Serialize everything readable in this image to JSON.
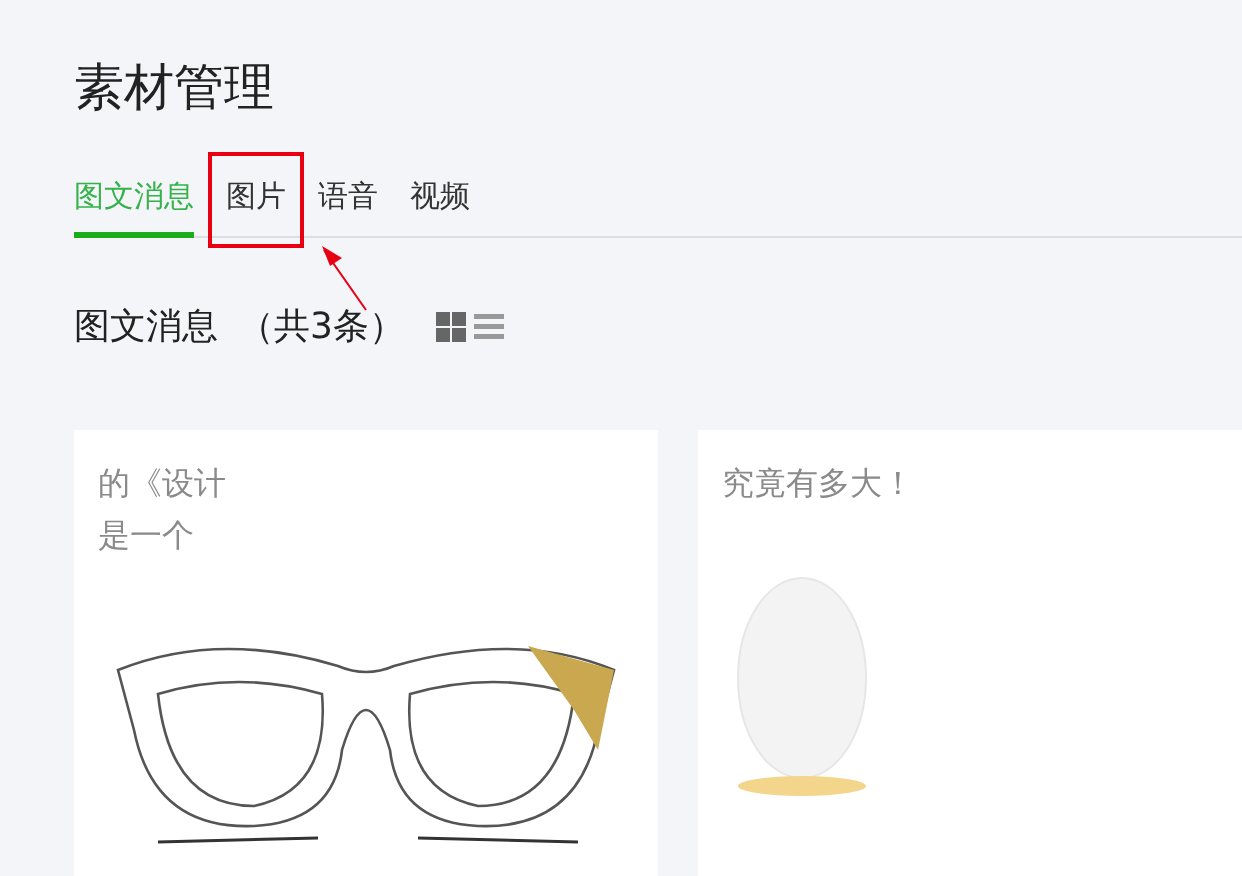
{
  "page_title": "素材管理",
  "tabs": [
    {
      "label": "图文消息",
      "selected": true,
      "highlighted": false
    },
    {
      "label": "图片",
      "selected": false,
      "highlighted": true
    },
    {
      "label": "语音",
      "selected": false,
      "highlighted": false
    },
    {
      "label": "视频",
      "selected": false,
      "highlighted": false
    }
  ],
  "section": {
    "title": "图文消息",
    "count": "（共3条）",
    "view_modes": [
      {
        "kind": "grid",
        "selected": true
      },
      {
        "kind": "list",
        "selected": false
      }
    ]
  },
  "cards": [
    {
      "kind": "glasses",
      "lines": [
        "的《设计",
        "是一个"
      ]
    },
    {
      "kind": "penguin",
      "lines": [
        "究竟有多大！"
      ]
    }
  ]
}
